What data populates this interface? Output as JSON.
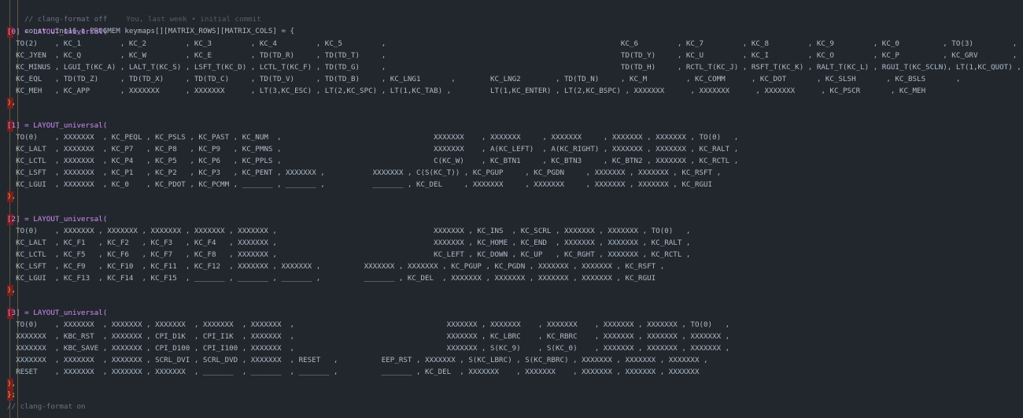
{
  "header": {
    "comment_off": "// clang-format off",
    "blame": "You, last week • initial commit",
    "decl": "const uint16_t PROGMEM keymaps[][MATRIX_ROWS][MATRIX_COLS] = {"
  },
  "layers": [
    {
      "title": "[0] = LAYOUT_universal(",
      "rows": [
        "  TO(2)    , KC_1         , KC_2         , KC_3         , KC_4         , KC_5         ,                                                      KC_6         , KC_7         , KC_8         , KC_9         , KC_0          , TO(3)         ,",
        "  KC_JYEN  , KC_Q         , KC_W         , KC_E         , TD(TD_R)     , TD(TD_T)     ,                                                      TD(TD_Y)     , KC_U         , KC_I         , KC_O         , KC_P          , KC_GRV        ,",
        "  KC_MINUS , LGUI_T(KC_A) , LALT_T(KC_S) , LSFT_T(KC_D) , LCTL_T(KC_F) , TD(TD_G)     ,                                                      TD(TD_H)     , RCTL_T(KC_J) , RSFT_T(KC_K) , RALT_T(KC_L) , RGUI_T(KC_SCLN), LT(1,KC_QUOT) ,",
        "  KC_EQL   , TD(TD_Z)     , TD(TD_X)     , TD(TD_C)     , TD(TD_V)     , TD(TD_B)     , KC_LNG1       ,        KC_LNG2        , TD(TD_N)     , KC_M         , KC_COMM      , KC_DOT       , KC_SLSH       , KC_BSLS       ,",
        "  KC_MEH   , KC_APP       , XXXXXXX      , XXXXXXX      , LT(3,KC_ESC) , LT(2,KC_SPC) , LT(1,KC_TAB) ,         LT(1,KC_ENTER) , LT(2,KC_BSPC) , XXXXXXX      , XXXXXXX      , XXXXXXX      , KC_PSCR       , KC_MEH"
      ],
      "close": "),"
    },
    {
      "title": "[1] = LAYOUT_universal(",
      "rows": [
        "  TO(0)    , XXXXXXX  , KC_PEQL , KC_PSLS , KC_PAST , KC_NUM  ,                                   XXXXXXX    , XXXXXXX     , XXXXXXX     , XXXXXXX , XXXXXXX , TO(0)   ,",
        "  KC_LALT  , XXXXXXX  , KC_P7   , KC_P8   , KC_P9   , KC_PMNS ,                                   XXXXXXX    , A(KC_LEFT)  , A(KC_RIGHT) , XXXXXXX , XXXXXXX , KC_RALT ,",
        "  KC_LCTL  , XXXXXXX  , KC_P4   , KC_P5   , KC_P6   , KC_PPLS ,                                   C(KC_W)    , KC_BTN1     , KC_BTN3     , KC_BTN2 , XXXXXXX , KC_RCTL ,",
        "  KC_LSFT  , XXXXXXX  , KC_P1   , KC_P2   , KC_P3   , KC_PENT , XXXXXXX ,           XXXXXXX , C(S(KC_T)) , KC_PGUP     , KC_PGDN     , XXXXXXX , XXXXXXX , KC_RSFT ,",
        "  KC_LGUI  , XXXXXXX  , KC_0    , KC_PDOT , KC_PCMM , _______ , _______ ,           _______ , KC_DEL     , XXXXXXX     , XXXXXXX     , XXXXXXX , XXXXXXX , KC_RGUI"
      ],
      "close": "),"
    },
    {
      "title": "[2] = LAYOUT_universal(",
      "rows": [
        "  TO(0)    , XXXXXXX , XXXXXXX , XXXXXXX , XXXXXXX , XXXXXXX ,                                    XXXXXXX , KC_INS  , KC_SCRL , XXXXXXX , XXXXXXX , TO(0)   ,",
        "  KC_LALT  , KC_F1   , KC_F2   , KC_F3   , KC_F4   , XXXXXXX ,                                    XXXXXXX , KC_HOME , KC_END  , XXXXXXX , XXXXXXX , KC_RALT ,",
        "  KC_LCTL  , KC_F5   , KC_F6   , KC_F7   , KC_F8   , XXXXXXX ,                                    KC_LEFT , KC_DOWN , KC_UP   , KC_RGHT , XXXXXXX , KC_RCTL ,",
        "  KC_LSFT  , KC_F9   , KC_F10  , KC_F11  , KC_F12  , XXXXXXX , XXXXXXX ,          XXXXXXX , XXXXXXX , KC_PGUP , KC_PGDN , XXXXXXX , XXXXXXX , KC_RSFT ,",
        "  KC_LGUI  , KC_F13  , KC_F14  , KC_F15  , _______ , _______ , _______ ,          _______ , KC_DEL  , XXXXXXX , XXXXXXX , XXXXXXX , XXXXXXX , KC_RGUI"
      ],
      "close": "),"
    },
    {
      "title": "[3] = LAYOUT_universal(",
      "rows": [
        "  TO(0)    , XXXXXXX  , XXXXXXX , XXXXXXX  , XXXXXXX  , XXXXXXX  ,                                   XXXXXXX , XXXXXXX    , XXXXXXX    , XXXXXXX , XXXXXXX , TO(0)   ,",
        "  XXXXXXX  , KBC_RST  , XXXXXXX , CPI_D1K  , CPI_I1K  , XXXXXXX  ,                                   XXXXXXX , KC_LBRC    , KC_RBRC    , XXXXXXX , XXXXXXX , XXXXXXX ,",
        "  XXXXXXX  , KBC_SAVE , XXXXXXX , CPI_D100 , CPI_I100 , XXXXXXX  ,                                   XXXXXXX , S(KC_9)    , S(KC_0)    , XXXXXXX , XXXXXXX , XXXXXXX ,",
        "  XXXXXXX  , XXXXXXX  , XXXXXXX , SCRL_DVI , SCRL_DVD , XXXXXXX  , RESET   ,          EEP_RST , XXXXXXX , S(KC_LBRC) , S(KC_RBRC) , XXXXXXX , XXXXXXX , XXXXXXX ,",
        "  RESET    , XXXXXXX  , XXXXXXX , XXXXXXX  , _______  , _______  , _______ ,          _______ , KC_DEL  , XXXXXXX    , XXXXXXX    , XXXXXXX , XXXXXXX , XXXXXXX"
      ],
      "close": "),"
    }
  ],
  "footer": {
    "close_brace": "};",
    "comment_on": "// clang-format on"
  },
  "colors": {
    "background": "#22272e",
    "keyword": "#f47067",
    "function": "#6cb6ff",
    "bracket": "#e0b450",
    "comment": "#6b7280"
  }
}
